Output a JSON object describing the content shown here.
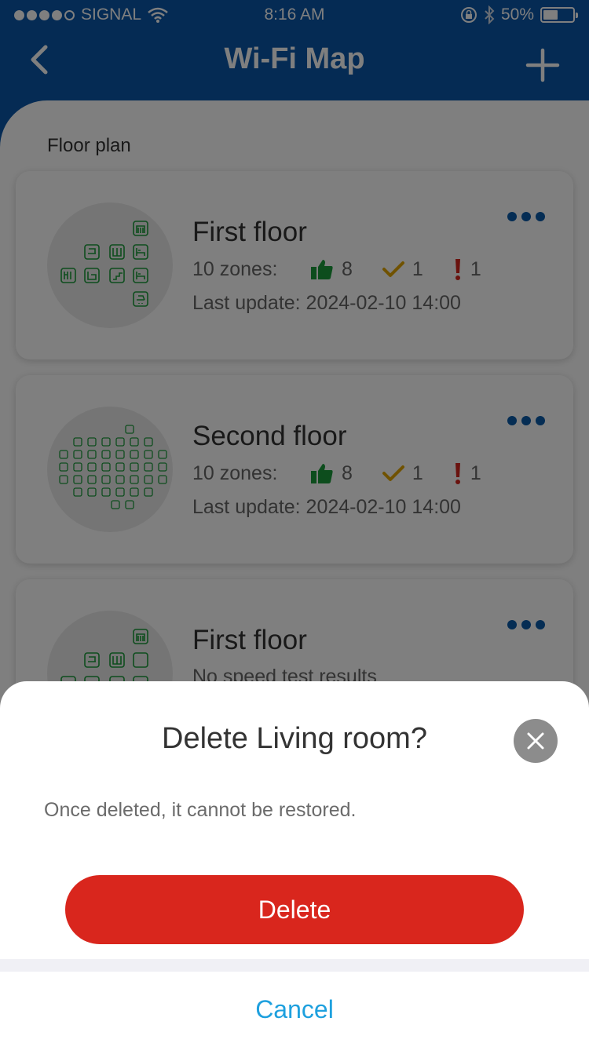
{
  "status_bar": {
    "carrier": "SIGNAL",
    "time": "8:16 AM",
    "battery": "50%",
    "battery_fraction": 0.5
  },
  "nav": {
    "title": "Wi-Fi Map",
    "back_icon": "chevron-left-icon",
    "add_icon": "plus-icon"
  },
  "section_label": "Floor plan",
  "cards": [
    {
      "name": "First floor",
      "zones": "10 zones:",
      "good": "8",
      "fair": "1",
      "poor": "1",
      "updated": "Last update: 2024-02-10 14:00"
    },
    {
      "name": "Second floor",
      "zones": "10 zones:",
      "good": "8",
      "fair": "1",
      "poor": "1",
      "updated": "Last update: 2024-02-10 14:00"
    },
    {
      "name": "First floor",
      "updated": "No speed test results"
    }
  ],
  "dialog": {
    "title": "Delete Living room?",
    "message": "Once deleted, it cannot be restored.",
    "delete_label": "Delete",
    "cancel_label": "Cancel"
  },
  "colors": {
    "brand_blue": "#0a56a8",
    "danger_red": "#d9261d",
    "link_blue": "#1ea0de",
    "good_green": "#1a9a3a",
    "fair_yellow": "#e0a400",
    "poor_red": "#d5271e"
  }
}
